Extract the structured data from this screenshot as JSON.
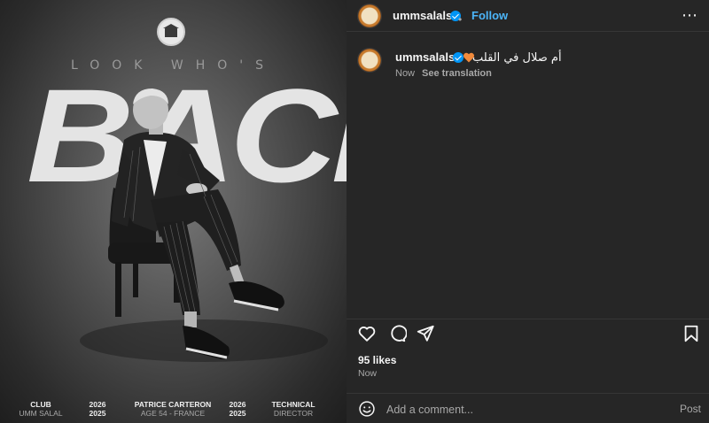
{
  "post": {
    "username": "ummsalalsc",
    "follow_label": "Follow",
    "dot": "•",
    "more_icon": "more-options-icon"
  },
  "media": {
    "tagline": "LOOK WHO'S",
    "headline": "BACK",
    "credits": {
      "club_title": "CLUB",
      "club_name": "UMM SALAL",
      "year_a_top": "2026",
      "year_a_bottom": "2025",
      "person_name": "PATRICE CARTERON",
      "person_info": "AGE 54 - FRANCE",
      "year_b_top": "2026",
      "year_b_bottom": "2025",
      "role_line1": "TECHNICAL",
      "role_line2": "DIRECTOR"
    }
  },
  "caption": {
    "username": "ummsalalsc",
    "text": "أم صلال في القلب",
    "time": "Now",
    "see_translation": "See translation"
  },
  "engagement": {
    "likes": "95 likes",
    "time": "Now"
  },
  "comment": {
    "placeholder": "Add a comment...",
    "post_label": "Post"
  },
  "colors": {
    "accent": "#4cb5f9",
    "verified": "#0095f6",
    "panel_bg": "#262626",
    "heart_emoji": "#f08a3c"
  }
}
